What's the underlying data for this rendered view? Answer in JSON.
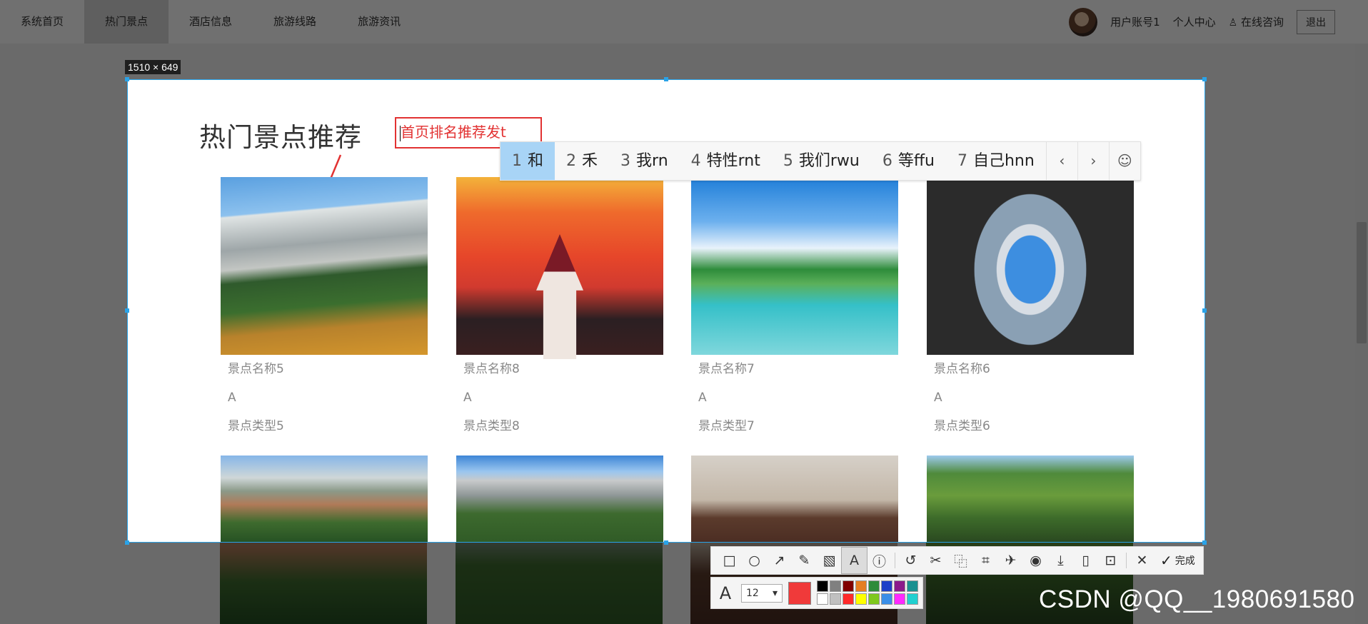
{
  "nav": {
    "items": [
      "系统首页",
      "热门景点",
      "酒店信息",
      "旅游线路",
      "旅游资讯"
    ],
    "active_index": 1,
    "user_account": "用户账号1",
    "personal_center": "个人中心",
    "online_consult": "在线咨询",
    "logout": "退出"
  },
  "selection": {
    "size_label": "1510 × 649"
  },
  "section": {
    "title": "热门景点推荐"
  },
  "annotation": {
    "text": "首页排名推荐发t",
    "color": "#e23232"
  },
  "ime": {
    "candidates": [
      {
        "num": "1",
        "text": "和"
      },
      {
        "num": "2",
        "text": "禾"
      },
      {
        "num": "3",
        "text": "我rn"
      },
      {
        "num": "4",
        "text": "特性rnt"
      },
      {
        "num": "5",
        "text": "我们rwu"
      },
      {
        "num": "6",
        "text": "等ffu"
      },
      {
        "num": "7",
        "text": "自己hnn"
      }
    ],
    "prev_icon": "‹",
    "next_icon": "›",
    "emoji_icon": "☺"
  },
  "cards": [
    {
      "name": "景点名称5",
      "grade": "A",
      "type": "景点类型5"
    },
    {
      "name": "景点名称8",
      "grade": "A",
      "type": "景点类型8"
    },
    {
      "name": "景点名称7",
      "grade": "A",
      "type": "景点类型7"
    },
    {
      "name": "景点名称6",
      "grade": "A",
      "type": "景点类型6"
    }
  ],
  "toolbar": {
    "done_label": "完成",
    "font_size": "12",
    "current_color": "#f03a3a",
    "palette": [
      "#000000",
      "#808080",
      "#800000",
      "#e67e22",
      "#2e8b3a",
      "#1e40c8",
      "#8b1a8b",
      "#1a9090",
      "#ffffff",
      "#c0c0c0",
      "#ff2a2a",
      "#ffff00",
      "#7ec81e",
      "#3a8ee8",
      "#ff2aff",
      "#20d0d0"
    ]
  },
  "watermark": "CSDN @QQ__1980691580"
}
